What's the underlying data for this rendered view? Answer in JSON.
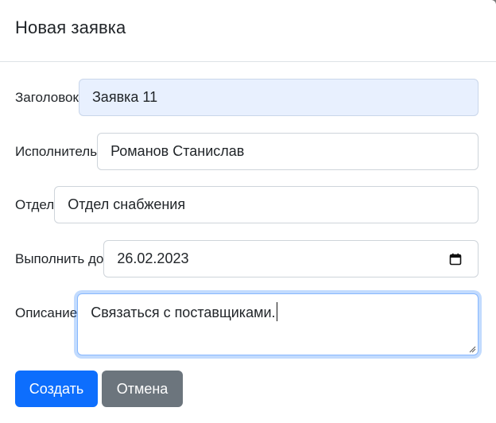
{
  "modal": {
    "title": "Новая заявка"
  },
  "form": {
    "title_label": "Заголовок",
    "title_value": "Заявка 11",
    "assignee_label": "Исполнитель",
    "assignee_value": "Романов Станислав",
    "department_label": "Отдел",
    "department_value": "Отдел снабжения",
    "due_label": "Выполнить до",
    "due_value": "26.02.2023",
    "description_label": "Описание",
    "description_value": "Связаться с поставщиками."
  },
  "buttons": {
    "create_label": "Создать",
    "cancel_label": "Отмена"
  },
  "colors": {
    "primary": "#0d6efd",
    "secondary": "#6c757d",
    "autofill_bg": "#e8f0fe",
    "focus_border": "#86b7fe"
  },
  "icons": {
    "date_picker": "calendar-icon",
    "textarea_resize": "resize-grip-icon"
  }
}
